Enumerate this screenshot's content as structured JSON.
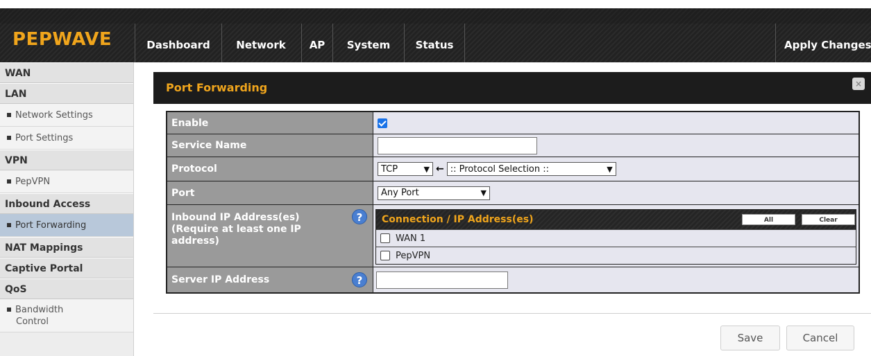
{
  "brand": {
    "logo": "PEPWAVE",
    "accent": "#f0a51c"
  },
  "nav": {
    "items": [
      {
        "label": "Dashboard"
      },
      {
        "label": "Network"
      },
      {
        "label": "AP"
      },
      {
        "label": "System"
      },
      {
        "label": "Status"
      }
    ],
    "active": "Network",
    "apply_label": "Apply Changes"
  },
  "sidebar": {
    "wan": "WAN",
    "lan": "LAN",
    "lan_items": [
      "Network Settings",
      "Port Settings"
    ],
    "vpn": "VPN",
    "vpn_items": [
      "PepVPN"
    ],
    "inbound": "Inbound Access",
    "inbound_items": [
      "Port Forwarding"
    ],
    "nat": "NAT Mappings",
    "captive": "Captive Portal",
    "qos": "QoS",
    "qos_items": {
      "line1": "Bandwidth",
      "line2": "Control"
    }
  },
  "panel": {
    "title": "Port Forwarding"
  },
  "form": {
    "enable_label": "Enable",
    "enable_checked": true,
    "service_name_label": "Service Name",
    "service_name_value": "",
    "protocol_label": "Protocol",
    "protocol_value": "TCP",
    "protocol_arrow": "←",
    "protocol_selection": ":: Protocol Selection ::",
    "port_label": "Port",
    "port_value": "Any Port",
    "inbound_label": "Inbound IP Address(es) (Require at least one IP address)",
    "server_ip_label": "Server IP Address",
    "server_ip_value": "",
    "help_glyph": "?"
  },
  "connections": {
    "header": "Connection / IP Address(es)",
    "all_label": "All",
    "clear_label": "Clear",
    "rows": [
      {
        "label": "WAN 1",
        "checked": false
      },
      {
        "label": "PepVPN",
        "checked": false
      }
    ]
  },
  "actions": {
    "save": "Save",
    "cancel": "Cancel"
  }
}
